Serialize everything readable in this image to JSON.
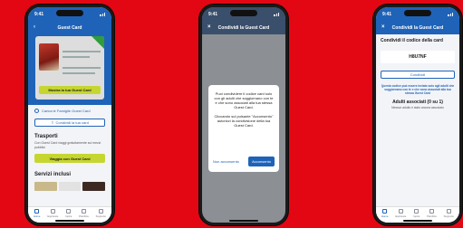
{
  "phone1": {
    "status_time": "9:41",
    "nav_title": "Guest Card",
    "show_card_button": "Mostra la tua Guest Card",
    "link_text": "Carica le Famiglie Guest Card",
    "share_button": "Condividi la tua card",
    "transport_title": "Trasporti",
    "transport_text": "Con Guest Card viaggi gratuitamente sui mezzi pubblici",
    "travel_button": "Viaggia con Guest Card",
    "services_title": "Servizi inclusi",
    "tabs": [
      "Home",
      "Esplorare",
      "Ispira",
      "Pianifica",
      "Supporto"
    ]
  },
  "phone2": {
    "status_time": "9:41",
    "nav_title": "Condividi la Guest Card",
    "dialog_text1": "Puoi condividere il codice card solo con gli adulti che soggiornano con te e che sono associati alla tua stessa Guest Card.",
    "dialog_text2": "Cliccando sul pulsante \"Acconsento\" autorizzi la condivisione della tua Guest Card.",
    "cancel_label": "Non acconsento",
    "confirm_label": "Acconsento"
  },
  "phone3": {
    "status_time": "9:41",
    "nav_title": "Condividi la Guest Card",
    "modal_title": "Condividi il codice della card",
    "code": "H8U7NF",
    "share_button": "Condividi",
    "warning": "Questo codice può essere inviato solo agli adulti che soggiornano con te e che sono associati alla tua stessa Guest Card",
    "sub_title": "Adulti associati (0 su 1)",
    "sub_body": "Nessun adulto è stato ancora associato",
    "tabs": [
      "Home",
      "Esplorare",
      "Ispira",
      "Pianifica",
      "Supporto"
    ]
  },
  "colors": {
    "background": "#e30613",
    "brand_blue": "#1f63b8",
    "lime": "#c6d631"
  }
}
